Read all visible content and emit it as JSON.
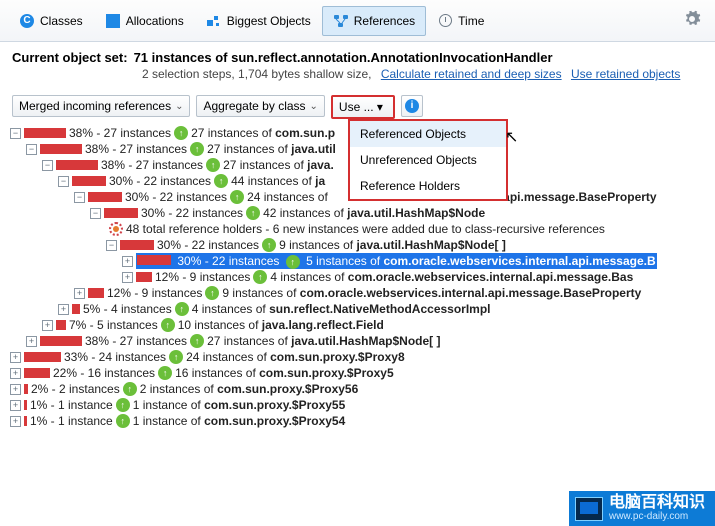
{
  "toolbar": {
    "classes": "Classes",
    "allocations": "Allocations",
    "biggest": "Biggest Objects",
    "references": "References",
    "time": "Time"
  },
  "header": {
    "label": "Current object set:",
    "value": "71 instances of sun.reflect.annotation.AnnotationInvocationHandler",
    "sub1": "2 selection steps, 1,704 bytes shallow size,",
    "link1": "Calculate retained and deep sizes",
    "link2": "Use retained objects"
  },
  "controls": {
    "merged": "Merged incoming references",
    "aggregate": "Aggregate by class",
    "use": "Use ...  ▾"
  },
  "menu": {
    "m1": "Referenced Objects",
    "m2": "Unreferenced Objects",
    "m3": "Reference Holders"
  },
  "tree": {
    "r0": {
      "pct": "38% - 27 instances",
      "txt": "27 instances of",
      "cls": "com.sun.p"
    },
    "r1": {
      "pct": "38% - 27 instances",
      "txt": "27 instances of",
      "cls": "java.util"
    },
    "r2": {
      "pct": "38% - 27 instances",
      "txt": "27 instances of",
      "cls": "java."
    },
    "r3": {
      "pct": "30% - 22 instances",
      "txt": "44 instances of",
      "cls": "ja"
    },
    "r4": {
      "pct": "30% - 22 instances",
      "txt": "24 instances of",
      "cls": "ernal.api.message.BaseProperty"
    },
    "r5": {
      "pct": "30% - 22 instances",
      "txt": "42 instances of",
      "cls": "java.util.HashMap$Node"
    },
    "r6": {
      "txt": "48 total reference holders - 6 new instances were added due to class-recursive references"
    },
    "r7": {
      "pct": "30% - 22 instances",
      "txt": "9 instances of",
      "cls": "java.util.HashMap$Node[ ]"
    },
    "r8": {
      "pct": "30% - 22 instances",
      "txt": "5 instances of",
      "cls": "com.oracle.webservices.internal.api.message.B"
    },
    "r9": {
      "pct": "12% - 9 instances",
      "txt": "4 instances of",
      "cls": "com.oracle.webservices.internal.api.message.Bas"
    },
    "r10": {
      "pct": "12% - 9 instances",
      "txt": "9 instances of",
      "cls": "com.oracle.webservices.internal.api.message.BaseProperty"
    },
    "r11": {
      "pct": "5% - 4 instances",
      "txt": "4 instances of",
      "cls": "sun.reflect.NativeMethodAccessorImpl"
    },
    "r12": {
      "pct": "7% - 5 instances",
      "txt": "10 instances of",
      "cls": "java.lang.reflect.Field"
    },
    "r13": {
      "pct": "38% - 27 instances",
      "txt": "27 instances of",
      "cls": "java.util.HashMap$Node[ ]"
    },
    "r14": {
      "pct": "33% - 24 instances",
      "txt": "24 instances of",
      "cls": "com.sun.proxy.$Proxy8"
    },
    "r15": {
      "pct": "22% - 16 instances",
      "txt": "16 instances of",
      "cls": "com.sun.proxy.$Proxy5"
    },
    "r16": {
      "pct": "2% - 2 instances",
      "txt": "2 instances of",
      "cls": "com.sun.proxy.$Proxy56"
    },
    "r17": {
      "pct": "1% - 1 instance",
      "txt": "1 instance of",
      "cls": "com.sun.proxy.$Proxy55"
    },
    "r18": {
      "pct": "1% - 1 instance",
      "txt": "1 instance of",
      "cls": "com.sun.proxy.$Proxy54"
    }
  },
  "watermark": {
    "t1": "电脑百科知识",
    "t2": "www.pc-daily.com"
  }
}
